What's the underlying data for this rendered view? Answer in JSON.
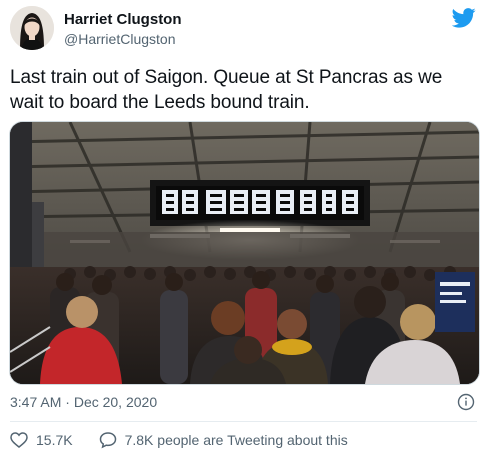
{
  "author": {
    "name": "Harriet Clugston",
    "handle": "@HarrietClugston"
  },
  "tweet": {
    "text": "Last train out of Saigon. Queue at St Pancras as we wait to board the Leeds bound train.",
    "time": "3:47 AM",
    "separator": "·",
    "date": "Dec 20, 2020"
  },
  "stats": {
    "likes": "15.7K",
    "tweeting": "7.8K people are Tweeting about this"
  },
  "colors": {
    "twitter_blue": "#1d9bf0",
    "secondary_text": "#536471"
  }
}
